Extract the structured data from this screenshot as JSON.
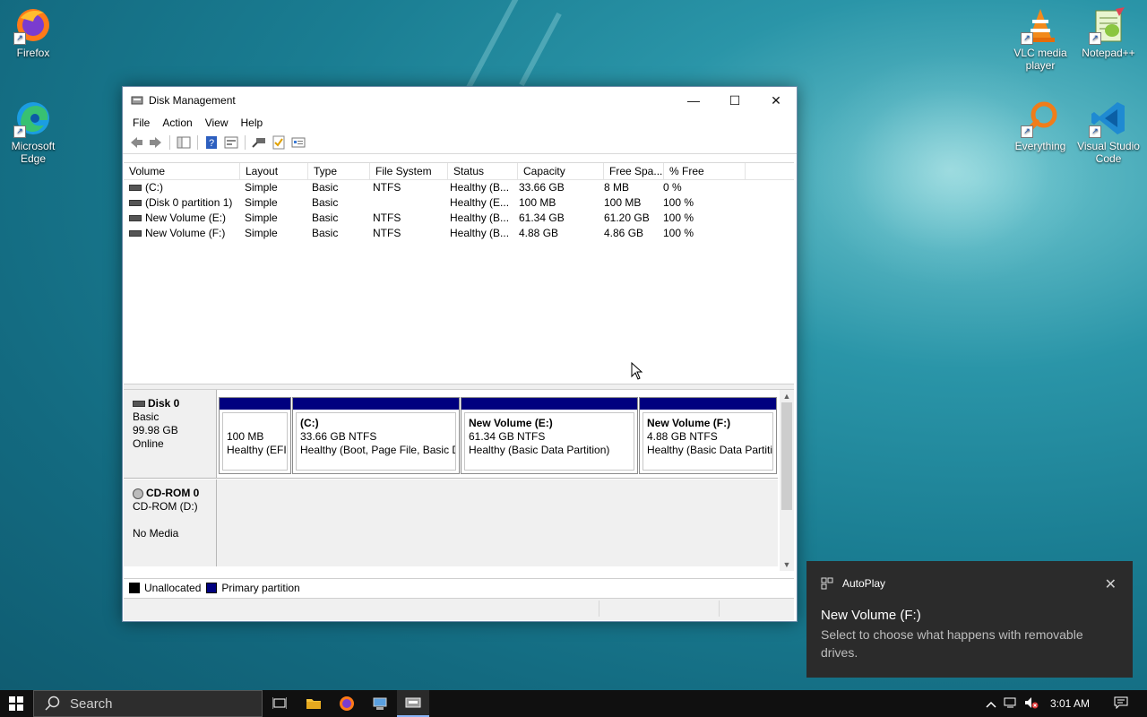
{
  "desktop": {
    "icons": [
      {
        "label": "Firefox"
      },
      {
        "label": "Microsoft Edge"
      },
      {
        "label": "VLC media player"
      },
      {
        "label": "Notepad++"
      },
      {
        "label": "Everything"
      },
      {
        "label": "Visual Studio Code"
      }
    ]
  },
  "window": {
    "title": "Disk Management",
    "minimize": "—",
    "maximize": "☐",
    "close": "✕",
    "menu": [
      "File",
      "Action",
      "View",
      "Help"
    ],
    "toolbar_icons": [
      "back-arrow-icon",
      "forward-arrow-icon",
      "console-tree-icon",
      "help-icon",
      "properties-icon",
      "connect-icon",
      "checklist-icon",
      "settings-icon"
    ],
    "columns": [
      "Volume",
      "Layout",
      "Type",
      "File System",
      "Status",
      "Capacity",
      "Free Spa...",
      "% Free"
    ],
    "rows": [
      [
        "(C:)",
        "Simple",
        "Basic",
        "NTFS",
        "Healthy (B...",
        "33.66 GB",
        "8 MB",
        "0 %"
      ],
      [
        "(Disk 0 partition 1)",
        "Simple",
        "Basic",
        "",
        "Healthy (E...",
        "100 MB",
        "100 MB",
        "100 %"
      ],
      [
        "New Volume (E:)",
        "Simple",
        "Basic",
        "NTFS",
        "Healthy (B...",
        "61.34 GB",
        "61.20 GB",
        "100 %"
      ],
      [
        "New Volume (F:)",
        "Simple",
        "Basic",
        "NTFS",
        "Healthy (B...",
        "4.88 GB",
        "4.86 GB",
        "100 %"
      ]
    ],
    "disks": {
      "disk0": {
        "name": "Disk 0",
        "type": "Basic",
        "size": "99.98 GB",
        "state": "Online",
        "partitions": [
          {
            "name": "",
            "size": "100 MB",
            "status": "Healthy (EFI"
          },
          {
            "name": "(C:)",
            "size": "33.66 GB NTFS",
            "status": "Healthy (Boot, Page File, Basic D"
          },
          {
            "name": "New Volume  (E:)",
            "size": "61.34 GB NTFS",
            "status": "Healthy (Basic Data Partition)"
          },
          {
            "name": "New Volume  (F:)",
            "size": "4.88 GB NTFS",
            "status": "Healthy (Basic Data Partitic"
          }
        ]
      },
      "cdrom": {
        "name": "CD-ROM 0",
        "type": "CD-ROM (D:)",
        "state": "No Media"
      }
    },
    "legend": [
      {
        "label": "Unallocated",
        "color": "#000000"
      },
      {
        "label": "Primary partition",
        "color": "#00007f"
      }
    ]
  },
  "toast": {
    "app": "AutoPlay",
    "title": "New Volume (F:)",
    "message": "Select to choose what happens with removable drives.",
    "close": "✕"
  },
  "taskbar": {
    "search_placeholder": "Search",
    "clock": "3:01 AM"
  }
}
